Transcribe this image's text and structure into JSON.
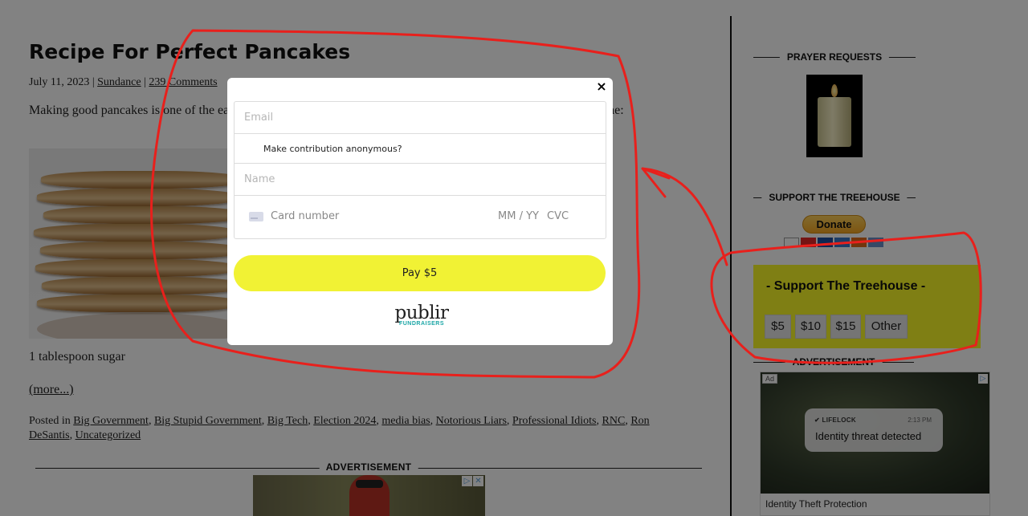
{
  "article": {
    "title": "Recipe For Perfect Pancakes",
    "date": "July 11, 2023",
    "author": "Sundance",
    "comments": "239 Comments",
    "sep": "|",
    "intro": "Making good pancakes is one of the easiest things to do. Just follow this recipe and remember this recipe next time:",
    "ingredient_line": "1 tablespoon sugar",
    "more_link": "(more...)",
    "posted_in_label": "Posted in",
    "categories": [
      "Big Government",
      "Big Stupid Government",
      "Big Tech",
      "Election 2024",
      "media bias",
      "Notorious Liars",
      "Professional Idiots",
      "RNC",
      "Ron DeSantis",
      "Uncategorized"
    ],
    "ad_label": "ADVERTISEMENT"
  },
  "sidebar": {
    "prayer_heading": "PRAYER REQUESTS",
    "support_heading": "SUPPORT THE TREEHOUSE",
    "donate_label": "Donate",
    "support_box_title": "- Support The Treehouse -",
    "amounts": [
      "$5",
      "$10",
      "$15",
      "Other"
    ],
    "ad_heading": "ADVERTISEMENT",
    "ad": {
      "tag": "Ad",
      "notif_app": "LIFELOCK",
      "notif_time": "2:13 PM",
      "notif_msg": "Identity threat detected",
      "caption": "Identity Theft Protection"
    }
  },
  "modal": {
    "close": "×",
    "email_placeholder": "Email",
    "anonymous_label": "Make contribution anonymous?",
    "name_placeholder": "Name",
    "card_number_placeholder": "Card number",
    "card_exp_placeholder": "MM / YY",
    "card_cvc_placeholder": "CVC",
    "pay_label": "Pay $5",
    "logo_word": "publir",
    "logo_sub": "FUNDRAISERS"
  },
  "colors": {
    "overlay": "#000000",
    "pay_button": "#f1f234",
    "support_box": "#fafa28",
    "annotation": "#e8201c",
    "logo_accent": "#1aa6a6"
  }
}
